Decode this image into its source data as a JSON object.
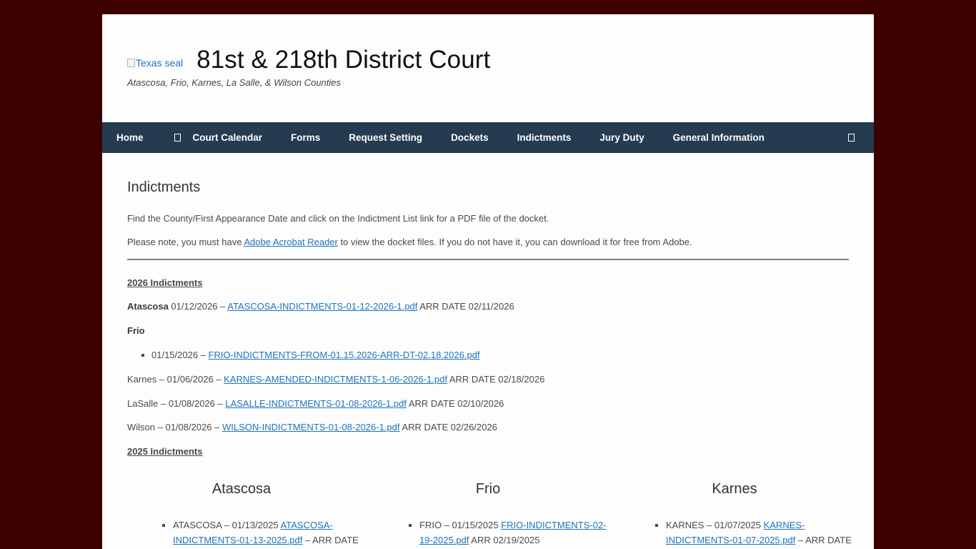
{
  "header": {
    "seal_alt": "Texas seal",
    "title": "81st & 218th District Court",
    "tagline": "Atascosa, Frio, Karnes, La Salle, & Wilson Counties"
  },
  "nav": {
    "items": [
      "Home",
      "Court Calendar",
      "Forms",
      "Request Setting",
      "Dockets",
      "Indictments",
      "Jury Duty",
      "General Information"
    ]
  },
  "page": {
    "title": "Indictments",
    "intro": "Find the County/First Appearance Date and click on the Indictment List link for a PDF file of the docket.",
    "note_before": "Please note, you must have ",
    "note_link": "Adobe Acrobat Reader",
    "note_after": " to view the docket files. If you do not have it, you can download it for free from Adobe."
  },
  "y2026": {
    "heading": "2026 Indictments",
    "atascosa": {
      "county": "Atascosa",
      "date": " 01/12/2026 – ",
      "link": "ATASCOSA-INDICTMENTS-01-12-2026-1.pdf",
      "after": " ARR DATE 02/11/2026"
    },
    "frio": {
      "county": "Frio",
      "date": "01/15/2026 – ",
      "link": "FRIO-INDICTMENTS-FROM-01.15.2026-ARR-DT-02.18.2026.pdf"
    },
    "karnes": {
      "prefix": "Karnes – 01/06/2026 – ",
      "link": "KARNES-AMENDED-INDICTMENTS-1-06-2026-1.pdf",
      "after": " ARR DATE 02/18/2026"
    },
    "lasalle": {
      "prefix": "LaSalle – 01/08/2026 – ",
      "link": "LASALLE-INDICTMENTS-01-08-2026-1.pdf",
      "after": " ARR DATE 02/10/2026"
    },
    "wilson": {
      "prefix": "Wilson – 01/08/2026 – ",
      "link": "WILSON-INDICTMENTS-01-08-2026-1.pdf",
      "after": " ARR DATE 02/26/2026"
    }
  },
  "y2025": {
    "heading": "2025 Indictments",
    "columns": [
      {
        "title": "Atascosa",
        "text": "ATASCOSA – 01/13/2025 ",
        "link": "ATASCOSA-INDICTMENTS-01-13-2025.pdf",
        "after": " – ARR DATE"
      },
      {
        "title": "Frio",
        "text": "FRIO – 01/15/2025 ",
        "link": "FRIO-INDICTMENTS-02-19-2025.pdf",
        "after": " ARR 02/19/2025"
      },
      {
        "title": "Karnes",
        "text": "KARNES – 01/07/2025 ",
        "link": "KARNES-INDICTMENTS-01-07-2025.pdf",
        "after": " – ARR DATE"
      }
    ]
  }
}
